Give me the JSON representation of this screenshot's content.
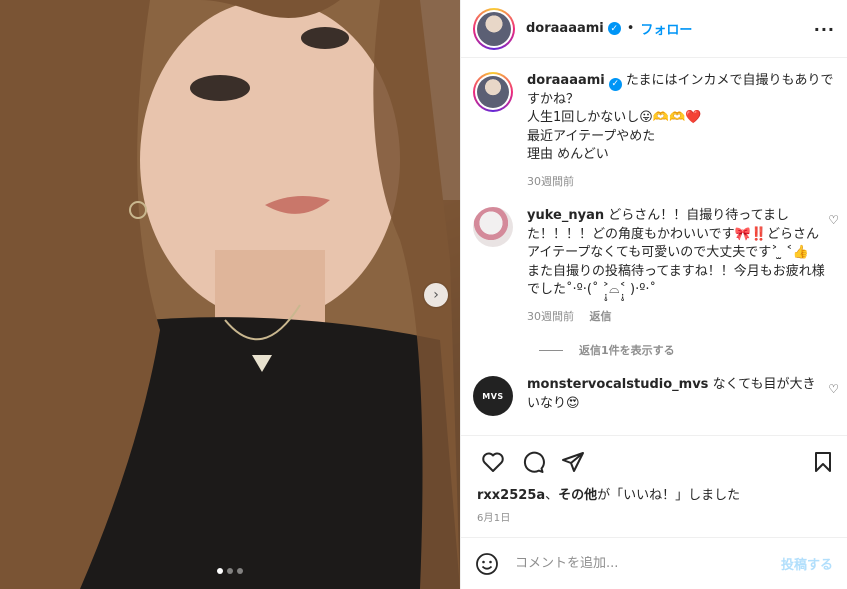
{
  "post": {
    "photo": {
      "carousel_count": 3,
      "active_index": 0,
      "next_icon": "chevron-right-icon"
    },
    "header": {
      "username": "doraaaami",
      "follow_label": "フォロー",
      "more_icon": "more-horizontal-icon"
    },
    "caption": {
      "username": "doraaaami",
      "lines": [
        "たまにはインカメで自撮りもありですかね？",
        "人生1回しかないし😛🫶🫶❤️",
        "最近アイテープやめた",
        "理由 めんどい"
      ],
      "time": "30週間前"
    },
    "comments": [
      {
        "username": "yuke_nyan",
        "text": "どらさん！！自撮り待ってました！！！！どの角度もかわいいです🎀‼️どらさんアイテープなくても可愛いので大丈夫です˃ ̫ ˂👍",
        "text2": "また自撮りの投稿待ってますね！！今月もお疲れ様でした˚‧º·(˚ ˃̣̣̥⌓˂̣̣̥ )‧º·˚",
        "time": "30週間前",
        "reply_label": "返信",
        "view_replies": "返信1件を表示する"
      },
      {
        "username": "monstervocalstudio_mvs",
        "avatar_text": "MVS",
        "text": "なくても目が大きいなり😍"
      }
    ],
    "likes": {
      "user": "rxx2525a",
      "others": "その他",
      "suffix": "が「いいね！」しました"
    },
    "date": "6月1日",
    "add_comment": {
      "placeholder": "コメントを追加...",
      "post_label": "投稿する"
    },
    "colors": {
      "accent": "#0095f6",
      "text": "#262626",
      "secondary": "#8e8e8e",
      "post_disabled": "#b2dffc"
    }
  }
}
